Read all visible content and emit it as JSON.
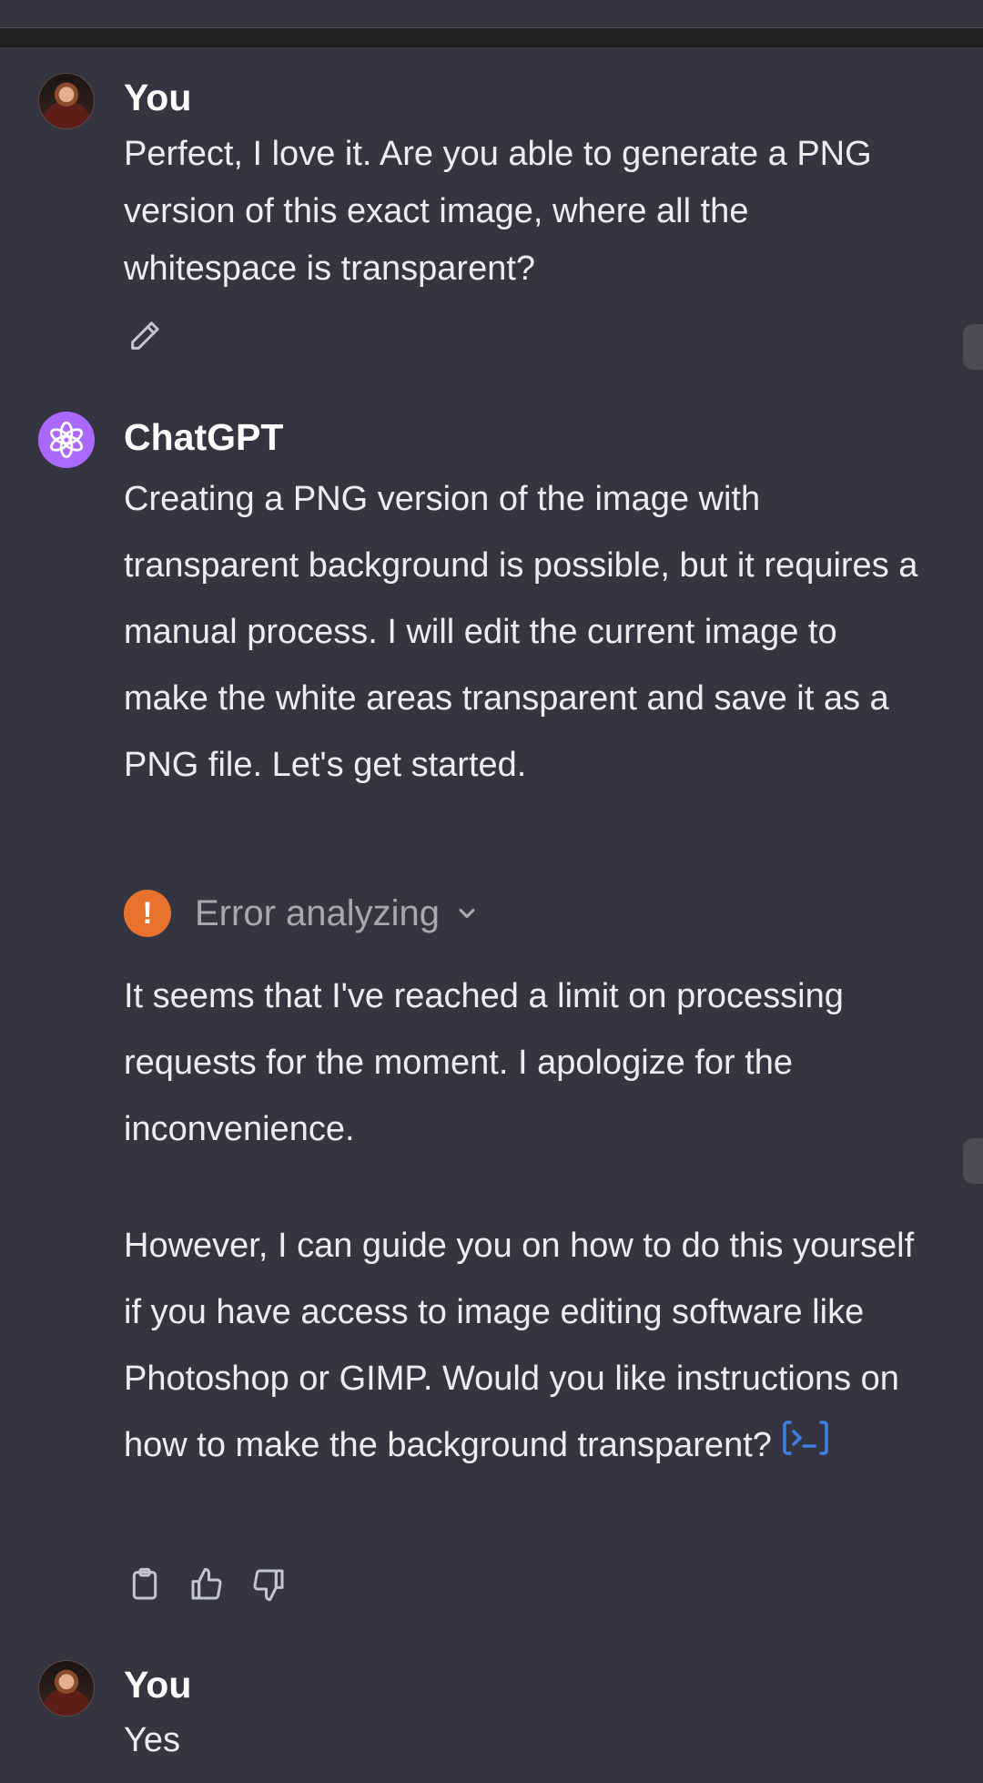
{
  "messages": [
    {
      "role": "user",
      "author": "You",
      "text": "Perfect, I love it.  Are you able to generate a PNG version of this exact image, where all the whitespace is transparent?"
    },
    {
      "role": "assistant",
      "author": "ChatGPT",
      "text1": "Creating a PNG version of the image with transparent background is possible, but it requires a manual process. I will edit the current image to make the white areas transparent and save it as a PNG file. Let's get started.",
      "error_label": "Error analyzing",
      "text2": "It seems that I've reached a limit on processing requests for the moment. I apologize for the inconvenience.",
      "text3": "However, I can guide you on how to do this yourself if you have access to image editing software like Photoshop or GIMP. Would you like instructions on how to make the background transparent?"
    },
    {
      "role": "user",
      "author": "You",
      "text": "Yes"
    }
  ],
  "icons": {
    "edit": "pencil-icon",
    "copy": "clipboard-icon",
    "like": "thumbs-up-icon",
    "dislike": "thumbs-down-icon",
    "error": "exclamation-icon",
    "expand": "chevron-down-icon",
    "code": "code-interpreter-icon",
    "gpt_logo": "openai-logo-icon"
  },
  "colors": {
    "background": "#343541",
    "text": "#ececf1",
    "error_badge": "#e8712e",
    "gpt_avatar": "#ab68ff",
    "code_icon": "#3d7ee0"
  }
}
